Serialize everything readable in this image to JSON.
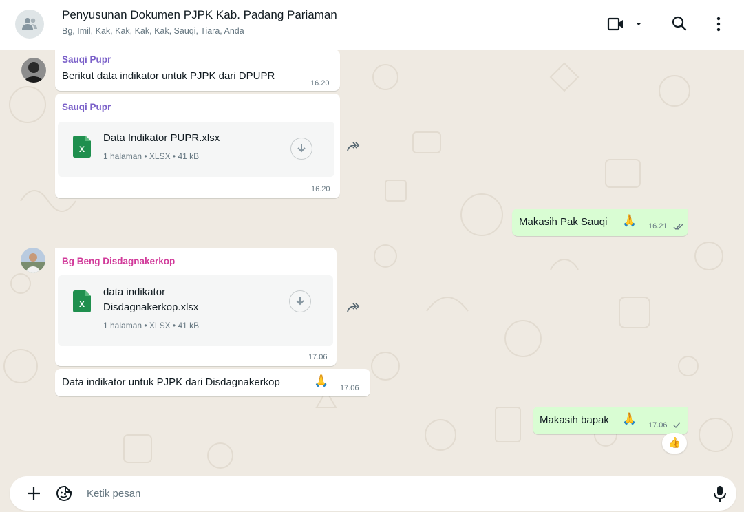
{
  "header": {
    "title": "Penyusunan Dokumen PJPK Kab. Padang Pariaman",
    "members": "Bg, Imil, Kak, Kak, Kak, Kak, Sauqi, Tiara, Anda"
  },
  "messages": [
    {
      "sender": "Sauqi Pupr",
      "text": "Berikut data indikator untuk PJPK dari DPUPR",
      "time": "16.20"
    },
    {
      "sender": "Sauqi Pupr",
      "document": {
        "name": "Data Indikator PUPR.xlsx",
        "meta": "1 halaman • XLSX • 41 kB"
      },
      "time": "16.20"
    },
    {
      "text": "Makasih Pak Sauqi",
      "emoji": "🙏",
      "time": "16.21",
      "status": "read"
    },
    {
      "sender": "Bg Beng Disdagnakerkop",
      "document": {
        "name_line1": "data indikator",
        "name_line2": "Disdagnakerkop.xlsx",
        "meta": "1 halaman • XLSX • 41 kB"
      },
      "time": "17.06"
    },
    {
      "text": "Data indikator untuk PJPK dari Disdagnakerkop",
      "emoji": "🙏",
      "time": "17.06"
    },
    {
      "text": "Makasih bapak",
      "emoji": "🙏",
      "time": "17.06",
      "status": "sent",
      "reaction": "👍"
    }
  ],
  "composer": {
    "placeholder": "Ketik pesan"
  },
  "colors": {
    "chat_bg": "#efeae2",
    "outgoing_bubble": "#d9fdd3",
    "sender_sauqi": "#7b61c9",
    "sender_bg_beng": "#d13a9a",
    "read_tick": "#53bdeb",
    "excel_green": "#1f8f4e"
  },
  "icons": [
    "group-avatar-icon",
    "video-call-icon",
    "chevron-down-icon",
    "search-icon",
    "menu-icon",
    "excel-file-icon",
    "download-icon",
    "forward-icon",
    "double-check-icon",
    "check-icon",
    "plus-icon",
    "sticker-icon",
    "mic-icon"
  ]
}
